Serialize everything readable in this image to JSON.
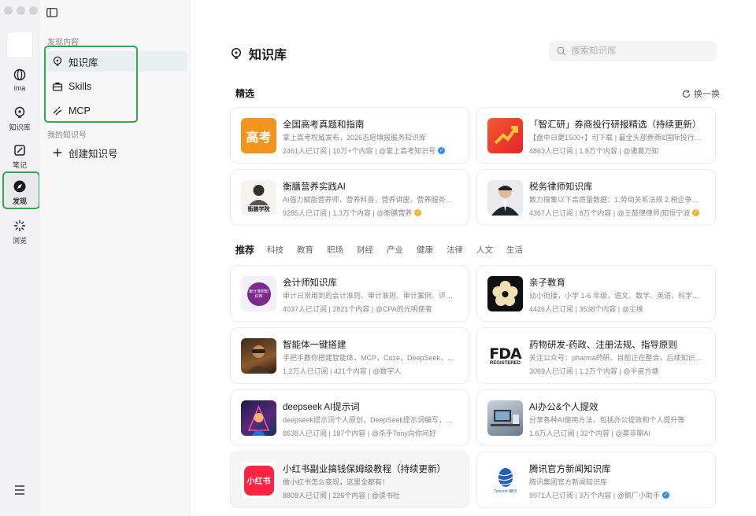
{
  "rail": {
    "items": [
      {
        "label": "ima"
      },
      {
        "label": "知识库"
      },
      {
        "label": "笔记"
      },
      {
        "label": "发现"
      },
      {
        "label": "浏览"
      }
    ]
  },
  "sidebar": {
    "discover_section": "发现内容",
    "items": [
      {
        "label": "知识库"
      },
      {
        "label": "Skills"
      },
      {
        "label": "MCP"
      }
    ],
    "my_section": "我的知识号",
    "create_label": "创建知识号"
  },
  "main": {
    "title": "知识库",
    "search_placeholder": "搜索知识库",
    "featured_title": "精选",
    "refresh_label": "换一换",
    "tabs": [
      "推荐",
      "科技",
      "教育",
      "职场",
      "财经",
      "产业",
      "健康",
      "法律",
      "人文",
      "生活"
    ],
    "featured": [
      {
        "title": "全国高考真题和指南",
        "desc": "掌上高考权威发布，2026志愿填报服务知识库",
        "subs": "2461人已订阅",
        "count": "10万+个内容",
        "author": "@掌上高考知识号",
        "badge": "blue"
      },
      {
        "title": "「智汇研」券商投行研报精选（持续更新）",
        "desc": "【盘中日更1500+】可下载 | 最全头部券商&国际投行证...",
        "subs": "4863人已订阅",
        "count": "1.8万个内容",
        "author": "@诸葛万知",
        "badge": ""
      },
      {
        "title": "衡膳营养实践AI",
        "desc": "AI强力赋能营养师，营养科普，营养讲座，营养服务、...",
        "subs": "9285人已订阅",
        "count": "1.3万个内容",
        "author": "@衡膳营养",
        "badge": "gold"
      },
      {
        "title": "税务律师知识库",
        "desc": "致力搜集以下高质量数据：1.劳动关系法规 2.税企争议...",
        "subs": "4367人已订阅",
        "count": "8万个内容",
        "author": "@王鼓律律师|知恒宁波",
        "badge": "gold"
      }
    ],
    "recommended": [
      {
        "title": "会计师知识库",
        "desc": "审计日常用到的会计准则、审计准则、审计案例、评估...",
        "subs": "4037人已订阅",
        "count": "2821个内容",
        "author": "@CPA的光明使者",
        "badge": ""
      },
      {
        "title": "亲子教育",
        "desc": "幼小衔接，小学 1-6 年级，语文、数学、英语、科学等...",
        "subs": "4426人已订阅",
        "count": "3538个内容",
        "author": "@尘埃",
        "badge": ""
      },
      {
        "title": "智能体一键搭建",
        "desc": "手把手教你搭建智能体，MCP，Coze，DeepSeek，AI...",
        "subs": "1.2万人已订阅",
        "count": "421个内容",
        "author": "@数字人",
        "badge": ""
      },
      {
        "title": "药物研发-药政、注册法规、指导原则",
        "desc": "关注公众号：pharma药研。目前正在整合，后续知识库...",
        "subs": "3069人已订阅",
        "count": "1.2万个内容",
        "author": "@半亩方塘",
        "badge": ""
      },
      {
        "title": "deepseek AI提示词",
        "desc": "deepseek提示词个人原创，DeepSeek提示词编写，AI...",
        "subs": "8638人已订阅",
        "count": "187个内容",
        "author": "@杀手Tony向你问好",
        "badge": ""
      },
      {
        "title": "AI办公&个人提效",
        "desc": "分享各种AI使用方法，包括办公提效和个人提升等",
        "subs": "1.6万人已订阅",
        "count": "32个内容",
        "author": "@莫非聊AI",
        "badge": ""
      },
      {
        "title": "小红书副业搞钱保姆级教程（持续更新）",
        "desc": "做小红书怎么变现，这里全都有！",
        "subs": "8809人已订阅",
        "count": "226个内容",
        "author": "@读书社",
        "badge": ""
      },
      {
        "title": "腾讯官方新闻知识库",
        "desc": "腾讯集团官方新闻知识库",
        "subs": "9971人已订阅",
        "count": "3万个内容",
        "author": "@鹅厂小助手",
        "badge": "blue"
      }
    ],
    "thumb_texts": {
      "gaokao": "高考",
      "hengshan": "衡膳学院",
      "fda_top": "FDA",
      "fda_bottom": "REGISTERED",
      "xhs": "小红书",
      "tencent": "Tencent 腾讯",
      "accounting": "审计准则知识库"
    }
  }
}
